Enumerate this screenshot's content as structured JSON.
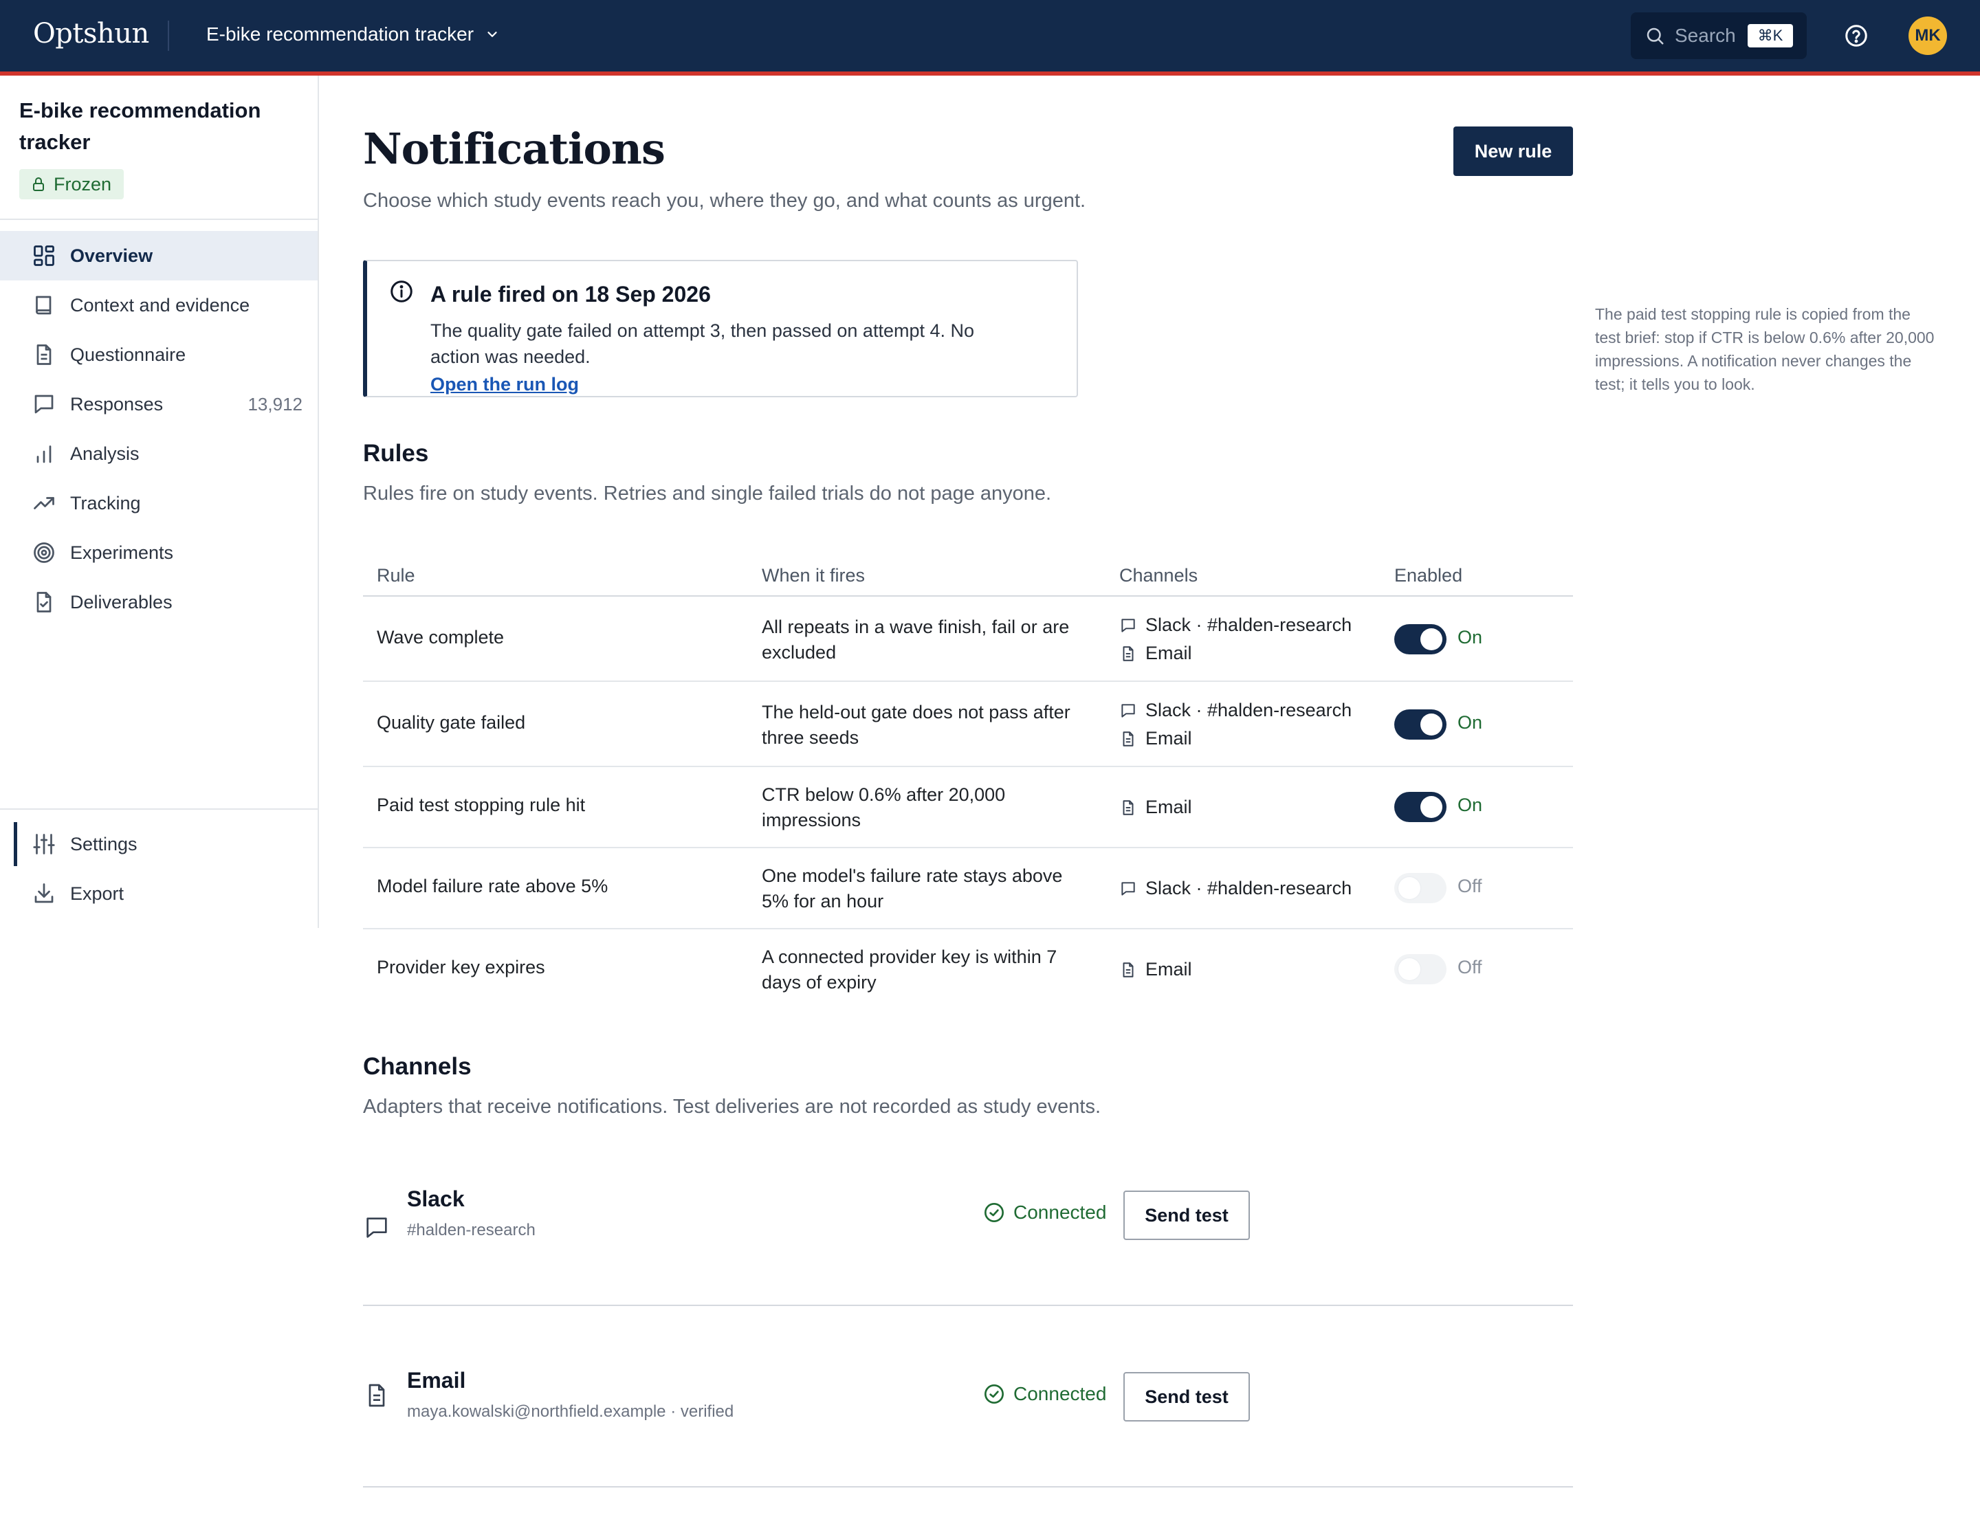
{
  "app": {
    "brand": "Optshun",
    "project_name": "E-bike recommendation tracker",
    "search_placeholder": "Search",
    "search_shortcut": "⌘K",
    "user_initials": "MK"
  },
  "sidebar": {
    "title": "E-bike recommendation tracker",
    "status_badge": "Frozen",
    "items": [
      {
        "label": "Overview",
        "icon": "overview-icon",
        "active": true
      },
      {
        "label": "Context and evidence",
        "icon": "book-icon"
      },
      {
        "label": "Questionnaire",
        "icon": "document-icon"
      },
      {
        "label": "Responses",
        "icon": "chat-icon",
        "count": "13,912"
      },
      {
        "label": "Analysis",
        "icon": "bar-chart-icon"
      },
      {
        "label": "Tracking",
        "icon": "trend-icon"
      },
      {
        "label": "Experiments",
        "icon": "target-icon"
      },
      {
        "label": "Deliverables",
        "icon": "file-check-icon"
      }
    ],
    "bottom_items": [
      {
        "label": "Settings",
        "icon": "sliders-icon"
      },
      {
        "label": "Export",
        "icon": "download-icon"
      }
    ]
  },
  "page": {
    "title": "Notifications",
    "subtitle": "Choose which study events reach you, where they go, and what counts as urgent.",
    "new_rule_label": "New rule"
  },
  "alert": {
    "title": "A rule fired on 18 Sep 2026",
    "body": "The quality gate failed on attempt 3, then passed on attempt 4. No action was needed.",
    "link": "Open the run log"
  },
  "side_note": "The paid test stopping rule is copied from the test brief: stop if CTR is below 0.6% after 20,000 impressions. A notification never changes the test; it tells you to look.",
  "rules": {
    "title": "Rules",
    "subtitle": "Rules fire on study events. Retries and single failed trials do not page anyone.",
    "columns": [
      "Rule",
      "When it fires",
      "Channels",
      "Enabled"
    ],
    "rows": [
      {
        "name": "Wave complete",
        "when": "All repeats in a wave finish, fail or are excluded",
        "channels": [
          "Slack · #halden-research",
          "Email"
        ],
        "enabled": "On"
      },
      {
        "name": "Quality gate failed",
        "when": "The held-out gate does not pass after three seeds",
        "channels": [
          "Slack · #halden-research",
          "Email"
        ],
        "enabled": "On"
      },
      {
        "name": "Paid test stopping rule hit",
        "when": "CTR below 0.6% after 20,000 impressions",
        "channels": [
          "Email"
        ],
        "enabled": "On"
      },
      {
        "name": "Model failure rate above 5%",
        "when": "One model's failure rate stays above 5% for an hour",
        "channels": [
          "Slack · #halden-research"
        ],
        "enabled": "Off"
      },
      {
        "name": "Provider key expires",
        "when": "A connected provider key is within 7 days of expiry",
        "channels": [
          "Email"
        ],
        "enabled": "Off"
      }
    ]
  },
  "channels": {
    "title": "Channels",
    "subtitle": "Adapters that receive notifications. Test deliveries are not recorded as study events.",
    "items": [
      {
        "name": "Slack",
        "detail": "#halden-research",
        "status": "Connected",
        "action": "Send test"
      },
      {
        "name": "Email",
        "detail": "maya.kowalski@northfield.example · verified",
        "status": "Connected",
        "action": "Send test"
      }
    ]
  },
  "colors": {
    "navy": "#132a4b",
    "accent_red": "#d0342c",
    "success_green": "#1f6b33",
    "link_blue": "#1a57b5",
    "avatar_yellow": "#f2b731"
  }
}
